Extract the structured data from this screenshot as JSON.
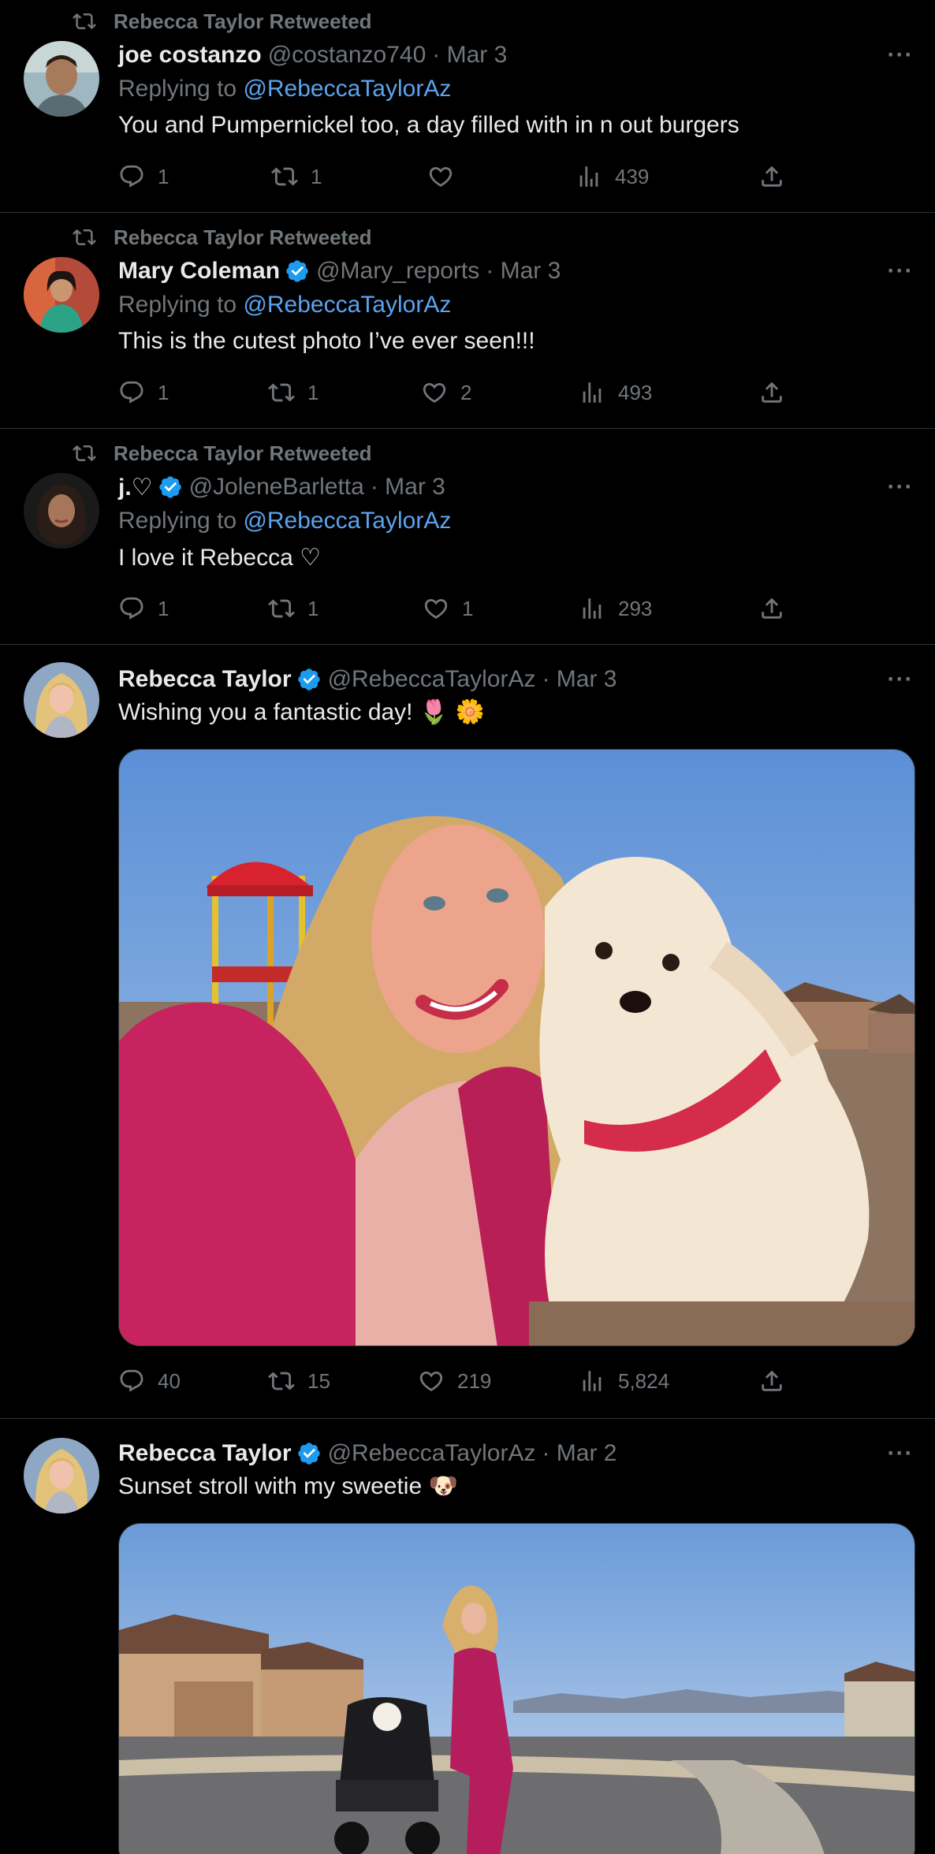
{
  "tweets": [
    {
      "retweeted_by": "Rebecca Taylor Retweeted",
      "name": "joe costanzo",
      "verified": false,
      "handle": "@costanzo740",
      "date": "· Mar 3",
      "reply_prefix": "Replying to",
      "reply_mention": "@RebeccaTaylorAz",
      "text": "You and Pumpernickel too, a day filled with in n out burgers",
      "replies": "1",
      "retweets": "1",
      "likes": "",
      "views": "439"
    },
    {
      "retweeted_by": "Rebecca Taylor Retweeted",
      "name": "Mary Coleman",
      "verified": true,
      "handle": "@Mary_reports",
      "date": "· Mar 3",
      "reply_prefix": "Replying to",
      "reply_mention": "@RebeccaTaylorAz",
      "text": "This is the cutest photo I’ve ever seen!!!",
      "replies": "1",
      "retweets": "1",
      "likes": "2",
      "views": "493"
    },
    {
      "retweeted_by": "Rebecca Taylor Retweeted",
      "name": "j.♡",
      "verified": true,
      "handle": "@JoleneBarletta",
      "date": "· Mar 3",
      "reply_prefix": "Replying to",
      "reply_mention": "@RebeccaTaylorAz",
      "text": "I love it Rebecca ♡",
      "replies": "1",
      "retweets": "1",
      "likes": "1",
      "views": "293"
    },
    {
      "name": "Rebecca Taylor",
      "verified": true,
      "handle": "@RebeccaTaylorAz",
      "date": "· Mar 3",
      "text": "Wishing you a fantastic day! 🌷 🌼",
      "replies": "40",
      "retweets": "15",
      "likes": "219",
      "views": "5,824"
    },
    {
      "name": "Rebecca Taylor",
      "verified": true,
      "handle": "@RebeccaTaylorAz",
      "date": "· Mar 2",
      "text": "Sunset stroll with my sweetie 🐶"
    }
  ],
  "icons": {
    "retweet": "retweet-icon",
    "verified": "verified-badge-icon",
    "more": "more-icon",
    "reply": "reply-icon",
    "like": "like-icon",
    "views": "views-icon",
    "share": "share-icon"
  },
  "colors": {
    "background": "#000000",
    "text": "#e7e9ea",
    "secondary": "#71767b",
    "accent": "#1d9bf0",
    "mention": "#5ba4ef",
    "divider": "#2f3336"
  }
}
